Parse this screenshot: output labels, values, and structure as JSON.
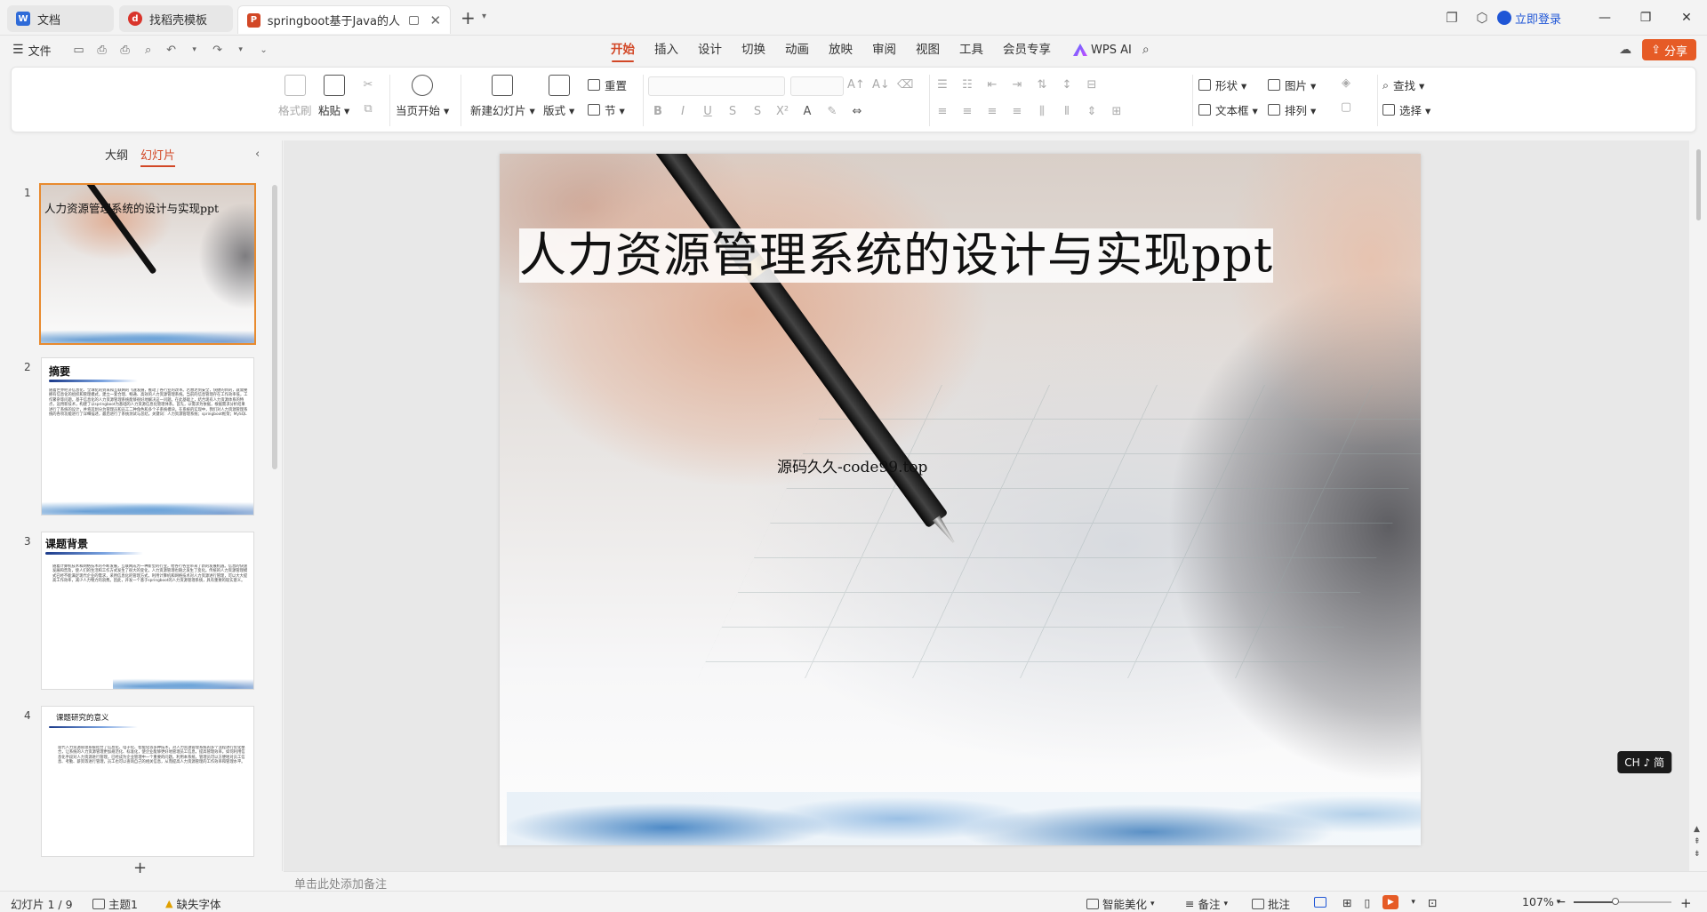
{
  "tabs": [
    {
      "label": "文档",
      "icon": "docs-icon",
      "color": "#2f6bd8"
    },
    {
      "label": "找稻壳模板",
      "icon": "docer-icon",
      "color": "#d9342b"
    },
    {
      "label": "springboot基于Java的人力",
      "icon": "ppt-icon",
      "color": "#d24726"
    }
  ],
  "titlebar": {
    "login": "立即登录"
  },
  "menubar": {
    "file": "文件",
    "tabs": [
      "开始",
      "插入",
      "设计",
      "切换",
      "动画",
      "放映",
      "审阅",
      "视图",
      "工具",
      "会员专享"
    ],
    "active_tab": "开始",
    "wps_ai": "WPS AI",
    "share": "分享"
  },
  "ribbon": {
    "format_painter": "格式刷",
    "paste": "粘贴",
    "play_from_current": "当页开始",
    "new_slide": "新建幻灯片",
    "layout": "版式",
    "reset": "重置",
    "section": "节",
    "shape": "形状",
    "picture": "图片",
    "textbox": "文本框",
    "arrange": "排列",
    "find": "查找",
    "select": "选择"
  },
  "leftpanel": {
    "tab_outline": "大纲",
    "tab_slides": "幻灯片",
    "slides": [
      {
        "num": "1",
        "title": "人力资源管理系统的设计与实现ppt"
      },
      {
        "num": "2",
        "title": "摘要",
        "text": "随着世界经济信息化、全球化的到来和互联网的飞速发展，推动了各行业的改革。若想达到安全，快捷的目的，就需要拥有信息化的组织和管理模式，建立一套合理、畅通、高效的人力资源管理系统。当前的信息管理存在工作效率低，工作繁杂等问题，基于信息化的人力资源管理系统能够很好地解决这一问题。在此基础上，结合现有人力资源体系的特点，运用新技术，构建了以springboot为基础的人力资源信息化管理体系。首先，以需求为依据，根据需求分析结果进行了系统的设计，并将其划分为管理员和员工二种角色和多个子系统模块。在系统的实现中，我们对人力资源管理系统的各项功能进行了详细描述，最后进行了系统测试与总结。关键词：人力资源管理系统；springboot框架；MySQL"
      },
      {
        "num": "3",
        "title": "课题背景",
        "text": "随着计算机技术和网络技术的不断发展，互联网成为一种新型的行业，给各行各业带来了新的发展机遇。信息的快速发展和普及，使人们的生活和工作方式发生了很大的变化，人力资源管理也随之发生了变化。传统的人力资源管理模式已经不能满足现代企业的需求，采用信息化的管理方式，利用计算机和网络技术对人力资源进行管理，可以大大提高工作效率，减少人力物力的浪费。因此，开发一个基于springboot的人力资源管理系统，具有重要的现实意义。"
      },
      {
        "num": "4",
        "title": "课题研究的意义",
        "text": "现代人力资源管理系统结合了信息化、电子化、智能化等多种技术，对人力资源管理系统的多个流程进行优化整合，让系统的人力资源管理更加规范化、标准化，使企业能够更好地管理员工信息，提高管理效率。如何利用信息化手段对人力资源进行管理，已经成为企业管理中一个重要的问题。利用本系统，管理员可以方便地对员工信息、考勤、薪资等进行管理，员工也可以查询自己的相关信息，从而提高人力资源管理的工作效率和管理水平。"
      }
    ]
  },
  "slide": {
    "title": "人力资源管理系统的设计与实现ppt",
    "subtitle": "源码久久-code99.top"
  },
  "ime_badge": "CH ♪ 简",
  "notes": {
    "placeholder": "单击此处添加备注"
  },
  "statusbar": {
    "slide_info": "幻灯片 1 / 9",
    "theme": "主题1",
    "missing_font": "缺失字体",
    "smart_beautify": "智能美化",
    "notes": "备注",
    "comments": "批注",
    "zoom": "107%",
    "zoom_level": 0.43
  }
}
